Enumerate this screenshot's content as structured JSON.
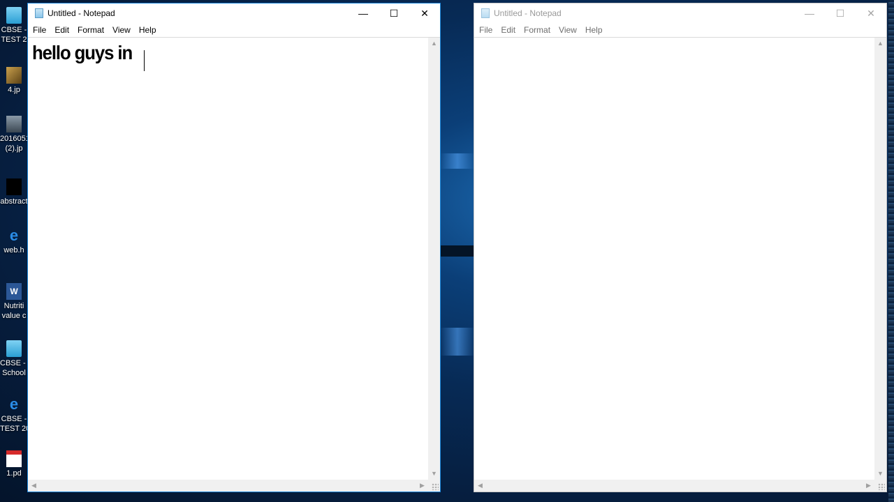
{
  "desktop": {
    "icons": [
      {
        "label": "CBSE -\nTEST 2",
        "icon": "folder-icon"
      },
      {
        "label": "4.jp",
        "icon": "image-file-icon"
      },
      {
        "label": "2016051\n(2).jp",
        "icon": "photo-file-icon"
      },
      {
        "label": "abstract",
        "icon": "image-file-icon"
      },
      {
        "label": "web.h",
        "icon": "internet-explorer-icon"
      },
      {
        "label": "Nutriti\nvalue c",
        "icon": "word-document-icon"
      },
      {
        "label": "CBSE - S\nSchool",
        "icon": "folder-icon"
      },
      {
        "label": "CBSE -\nTEST 20",
        "icon": "internet-explorer-icon"
      },
      {
        "label": "1.pd",
        "icon": "pdf-file-icon"
      }
    ]
  },
  "windows": [
    {
      "title": "Untitled - Notepad",
      "state": "active",
      "menu": [
        "File",
        "Edit",
        "Format",
        "View",
        "Help"
      ],
      "content": "hello guys in",
      "controls": {
        "minimize": "—",
        "maximize": "☐",
        "close": "✕"
      }
    },
    {
      "title": "Untitled - Notepad",
      "state": "inactive",
      "menu": [
        "File",
        "Edit",
        "Format",
        "View",
        "Help"
      ],
      "content": "",
      "controls": {
        "minimize": "—",
        "maximize": "☐",
        "close": "✕"
      }
    }
  ],
  "colors": {
    "active_border": "#1883d7",
    "inactive_border": "#c9c9c9",
    "desktop_blue": "#0b3f78"
  }
}
